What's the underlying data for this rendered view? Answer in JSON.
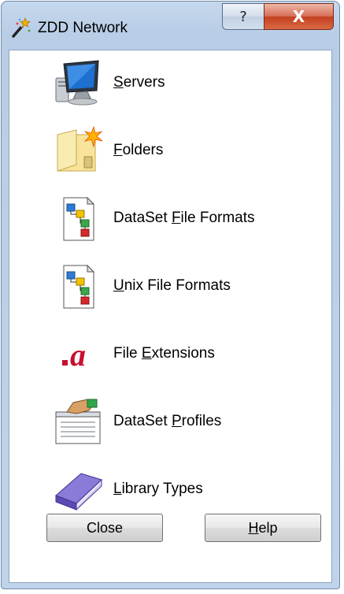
{
  "window": {
    "title": "ZDD Network",
    "help_caption_glyph": "?",
    "close_caption_glyph": "X"
  },
  "items": [
    {
      "pre": "",
      "key": "S",
      "post": "ervers",
      "icon": "computer-icon"
    },
    {
      "pre": "",
      "key": "F",
      "post": "olders",
      "icon": "new-folder-icon"
    },
    {
      "pre": "DataSet ",
      "key": "F",
      "post": "ile Formats",
      "icon": "file-format-icon"
    },
    {
      "pre": "",
      "key": "U",
      "post": "nix File Formats",
      "icon": "file-format-icon"
    },
    {
      "pre": "File ",
      "key": "E",
      "post": "xtensions",
      "icon": "file-extension-icon"
    },
    {
      "pre": "DataSet ",
      "key": "P",
      "post": "rofiles",
      "icon": "profile-form-icon"
    },
    {
      "pre": "",
      "key": "L",
      "post": "ibrary Types",
      "icon": "book-icon"
    }
  ],
  "buttons": {
    "close_label": "Close",
    "help_pre": "",
    "help_key": "H",
    "help_post": "elp"
  },
  "colors": {
    "titlebar": "#c6d8ed",
    "close_caption": "#c4401f",
    "extension_icon": "#c8102e"
  }
}
